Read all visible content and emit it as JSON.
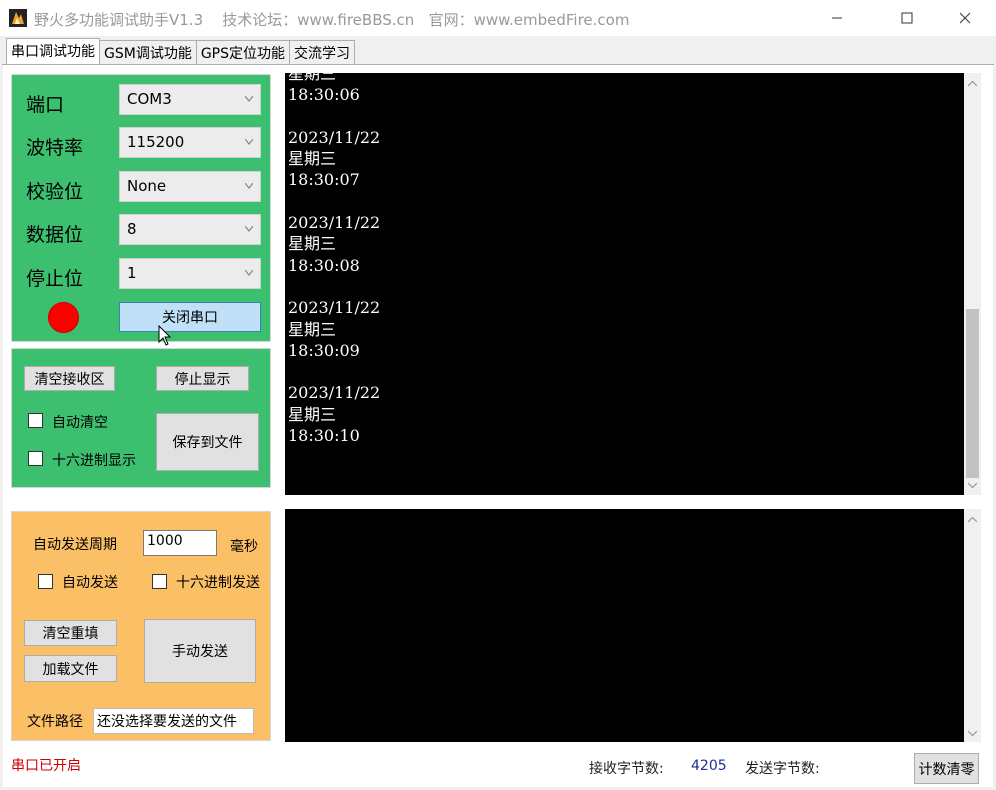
{
  "window": {
    "title": "野火多功能调试助手V1.3    技术论坛：www.fireBBS.cn   官网：www.embedFire.com",
    "minimize_label": "—",
    "maximize_label": "☐",
    "close_label": "✕"
  },
  "tabs": [
    {
      "label": "串口调试功能",
      "active": true
    },
    {
      "label": "GSM调试功能",
      "active": false
    },
    {
      "label": "GPS定位功能",
      "active": false
    },
    {
      "label": "交流学习",
      "active": false
    }
  ],
  "serial": {
    "port_label": "端口",
    "port_value": "COM3",
    "baud_label": "波特率",
    "baud_value": "115200",
    "parity_label": "校验位",
    "parity_value": "None",
    "databits_label": "数据位",
    "databits_value": "8",
    "stopbits_label": "停止位",
    "stopbits_value": "1",
    "status_led_color": "#ff0000",
    "toggle_button": "关闭串口"
  },
  "receive_controls": {
    "clear_button": "清空接收区",
    "stop_button": "停止显示",
    "auto_clear_label": "自动清空",
    "hex_display_label": "十六进制显示",
    "save_button": "保存到文件"
  },
  "receive_area": {
    "lines": [
      "星期三",
      "18:30:06",
      "",
      "2023/11/22",
      "星期三",
      "18:30:07",
      "",
      "2023/11/22",
      "星期三",
      "18:30:08",
      "",
      "2023/11/22",
      "星期三",
      "18:30:09",
      "",
      "2023/11/22",
      "星期三",
      "18:30:10"
    ]
  },
  "send_controls": {
    "period_label": "自动发送周期",
    "period_value": "1000",
    "period_unit": "毫秒",
    "auto_send_label": "自动发送",
    "hex_send_label": "十六进制发送",
    "clear_button": "清空重填",
    "load_button": "加载文件",
    "send_button": "手动发送",
    "file_path_label": "文件路径",
    "file_path_value": "还没选择要发送的文件"
  },
  "statusbar": {
    "port_status": "串口已开启",
    "recv_label": "接收字节数:",
    "recv_count": "4205",
    "send_label": "发送字节数:",
    "reset_button": "计数清零"
  },
  "colors": {
    "serial_panel": "#3cbf6e",
    "send_panel": "#fbc066",
    "terminal_bg": "#000000",
    "status_text": "#d00000"
  }
}
